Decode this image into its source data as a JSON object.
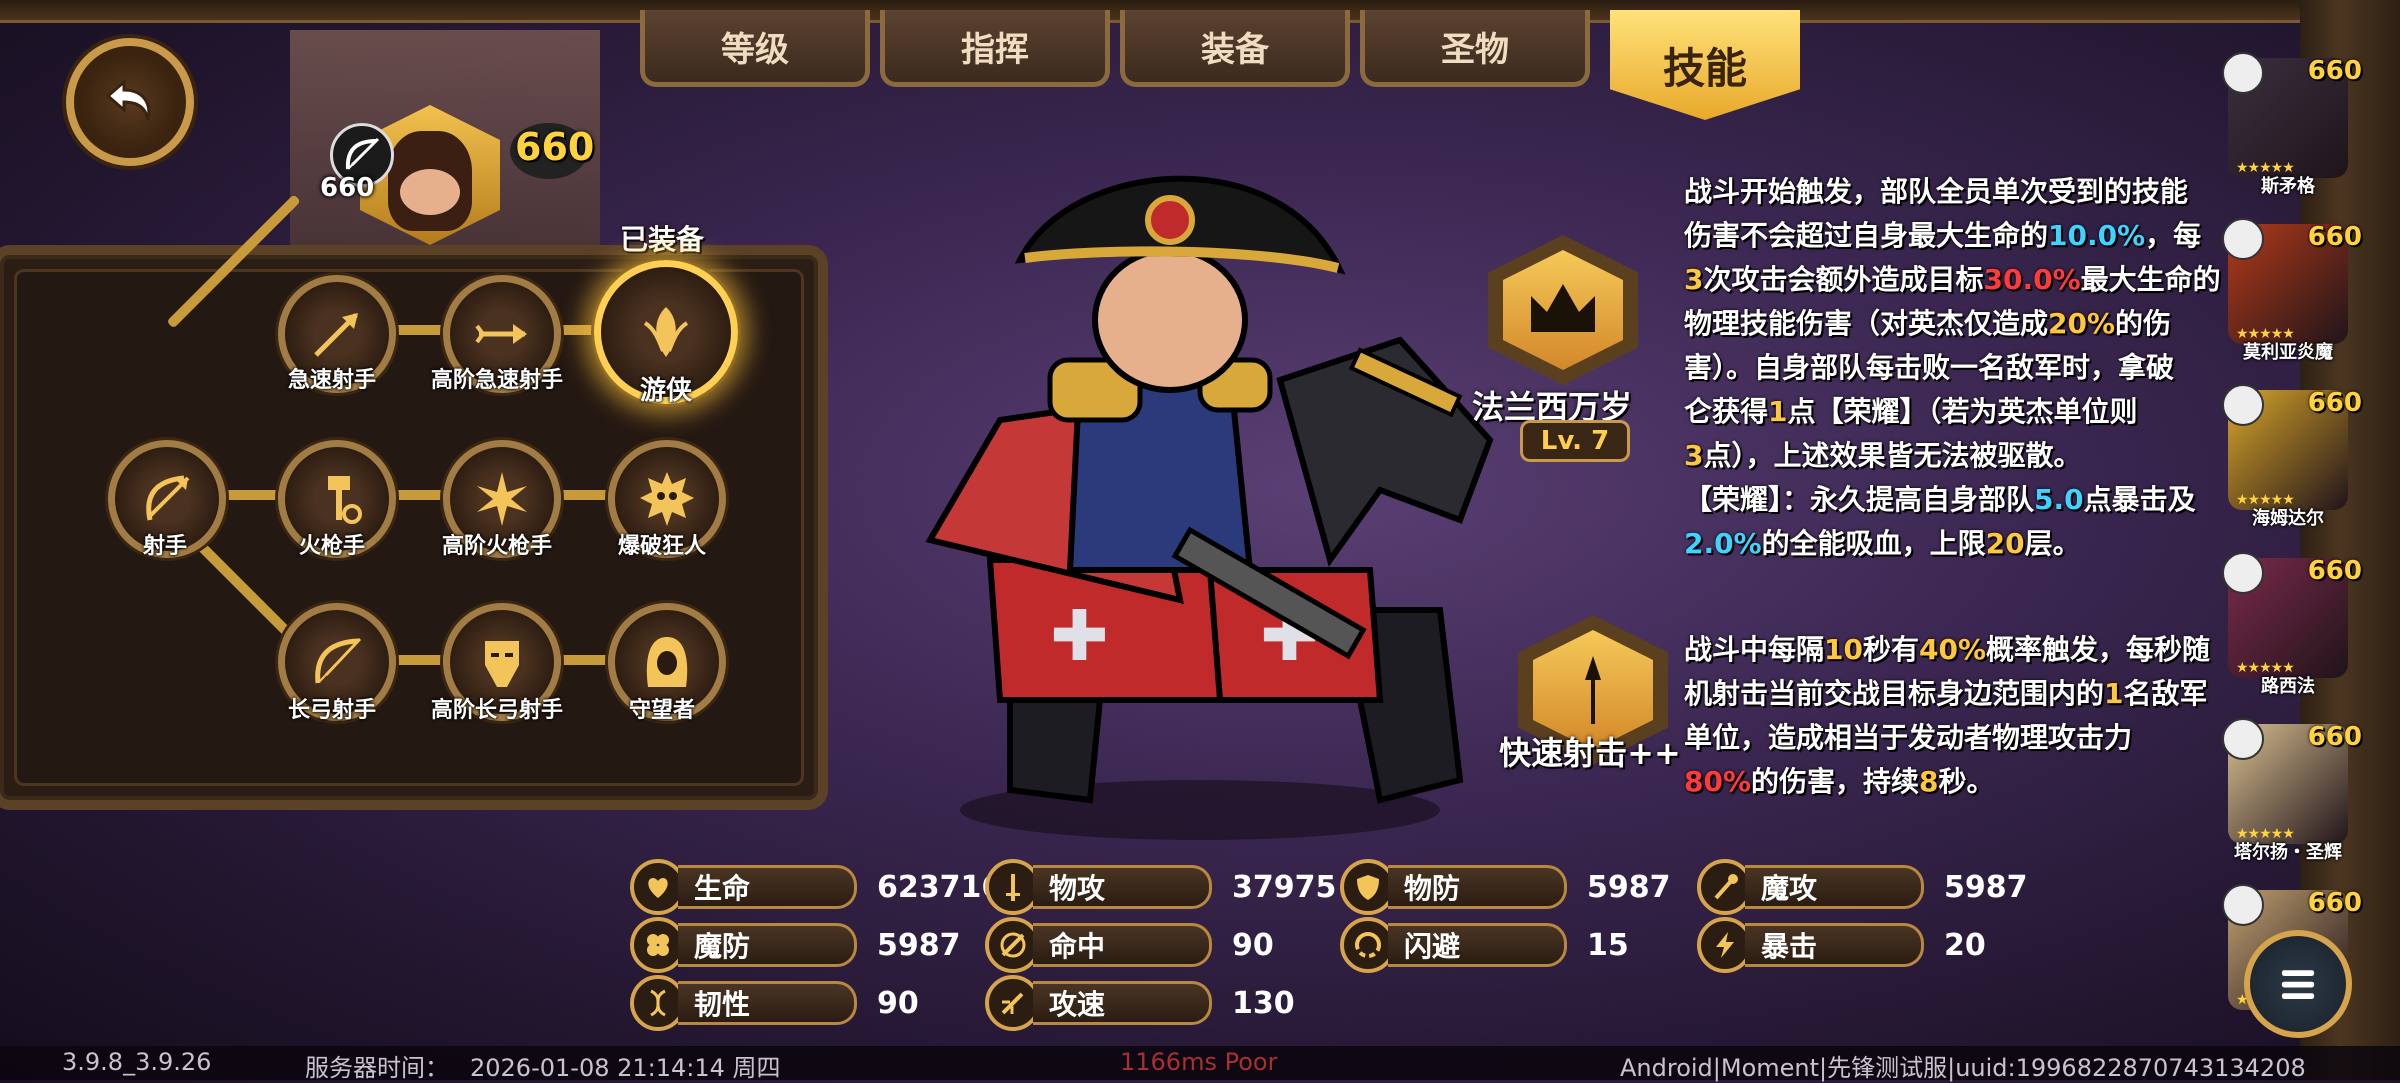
{
  "tabs": [
    {
      "label": "等级"
    },
    {
      "label": "指挥"
    },
    {
      "label": "装备"
    },
    {
      "label": "圣物"
    },
    {
      "label": "技能"
    }
  ],
  "hero": {
    "level_small": "660",
    "level_big": "660",
    "class_icon": "bow-icon"
  },
  "class_tree": {
    "equipped_label": "已装备",
    "nodes": [
      {
        "label": "射手",
        "icon": "bow-arrow-icon"
      },
      {
        "label": "急速射手",
        "icon": "arrow-icon"
      },
      {
        "label": "高阶急速射手",
        "icon": "triple-arrow-icon"
      },
      {
        "label": "游侠",
        "icon": "leaf-crest-icon",
        "equipped": true
      },
      {
        "label": "火枪手",
        "icon": "hammer-gear-icon"
      },
      {
        "label": "高阶火枪手",
        "icon": "starburst-icon"
      },
      {
        "label": "爆破狂人",
        "icon": "skull-burst-icon"
      },
      {
        "label": "长弓射手",
        "icon": "longbow-icon"
      },
      {
        "label": "高阶长弓射手",
        "icon": "mask-icon"
      },
      {
        "label": "守望者",
        "icon": "hood-icon"
      }
    ]
  },
  "skills": [
    {
      "name": "法兰西万岁",
      "level": "Lv. 7",
      "icon": "crown-icon",
      "lines": [
        [
          {
            "t": "战斗开始触发，部队全员单次受到的技能"
          }
        ],
        [
          {
            "t": "伤害不会超过自身最大生命的"
          },
          {
            "t": "10.0%",
            "c": "blue"
          },
          {
            "t": "，每"
          }
        ],
        [
          {
            "t": "3",
            "c": "yellow"
          },
          {
            "t": "次攻击会额外造成目标"
          },
          {
            "t": "30.0%",
            "c": "red"
          },
          {
            "t": "最大生命的"
          }
        ],
        [
          {
            "t": "物理技能伤害（对英杰仅造成"
          },
          {
            "t": "20%",
            "c": "yellow"
          },
          {
            "t": "的伤"
          }
        ],
        [
          {
            "t": "害）。自身部队每击败一名敌军时，拿破"
          }
        ],
        [
          {
            "t": "仑获得"
          },
          {
            "t": "1",
            "c": "yellow"
          },
          {
            "t": "点【荣耀】（若为英杰单位则"
          }
        ],
        [
          {
            "t": "3",
            "c": "yellow"
          },
          {
            "t": "点），上述效果皆无法被驱散。"
          }
        ],
        [
          {
            "t": "【荣耀】：永久提高自身部队"
          },
          {
            "t": "5.0",
            "c": "blue"
          },
          {
            "t": "点暴击及"
          }
        ],
        [
          {
            "t": "2.0%",
            "c": "blue"
          },
          {
            "t": "的全能吸血，上限"
          },
          {
            "t": "20",
            "c": "yellow"
          },
          {
            "t": "层。"
          }
        ]
      ]
    },
    {
      "name": "快速射击++",
      "icon": "spear-icon",
      "lines": [
        [
          {
            "t": "战斗中每隔"
          },
          {
            "t": "10",
            "c": "yellow"
          },
          {
            "t": "秒有"
          },
          {
            "t": "40%",
            "c": "yellow"
          },
          {
            "t": "概率触发，每秒随"
          }
        ],
        [
          {
            "t": "机射击当前交战目标身边范围内的"
          },
          {
            "t": "1",
            "c": "yellow"
          },
          {
            "t": "名敌军"
          }
        ],
        [
          {
            "t": "单位，造成相当于发动者物理攻击力"
          }
        ],
        [
          {
            "t": "80%",
            "c": "red"
          },
          {
            "t": "的伤害，持续"
          },
          {
            "t": "8",
            "c": "yellow"
          },
          {
            "t": "秒。"
          }
        ]
      ]
    }
  ],
  "stats": [
    {
      "label": "生命",
      "value": "623716",
      "icon": "heart-icon"
    },
    {
      "label": "物攻",
      "value": "37975",
      "icon": "sword-icon"
    },
    {
      "label": "物防",
      "value": "5987",
      "icon": "shield-icon"
    },
    {
      "label": "魔攻",
      "value": "5987",
      "icon": "staff-icon"
    },
    {
      "label": "魔防",
      "value": "5987",
      "icon": "clover-icon"
    },
    {
      "label": "命中",
      "value": "90",
      "icon": "target-icon"
    },
    {
      "label": "闪避",
      "value": "15",
      "icon": "dodge-icon"
    },
    {
      "label": "暴击",
      "value": "20",
      "icon": "lightning-icon"
    },
    {
      "label": "韧性",
      "value": "90",
      "icon": "dna-icon"
    },
    {
      "label": "攻速",
      "value": "130",
      "icon": "speed-icon"
    }
  ],
  "hero_list": [
    {
      "name": "斯矛格",
      "level": "660",
      "color": "#3b2f3f"
    },
    {
      "name": "莫利亚炎魔",
      "level": "660",
      "color": "#b23a1a"
    },
    {
      "name": "海姆达尔",
      "level": "660",
      "color": "#d9a62a"
    },
    {
      "name": "路西法",
      "level": "660",
      "color": "#7a2a4a"
    },
    {
      "name": "塔尔扬・圣辉",
      "level": "660",
      "color": "#d9c090"
    },
    {
      "name": "",
      "level": "660",
      "color": "#c0a070"
    }
  ],
  "colors": {
    "accent": "#ffd23e",
    "blue": "#3fd3ff",
    "red": "#ff3a3a",
    "yellow": "#ffc83a"
  },
  "footer": {
    "version": "3.9.8_3.9.26",
    "server_time_label": "服务器时间：",
    "server_time": "2026-01-08  21:14:14  周四",
    "latency": "1166ms Poor",
    "device": "Android|Moment|先锋测试服|uuid:1996822870743134208"
  }
}
